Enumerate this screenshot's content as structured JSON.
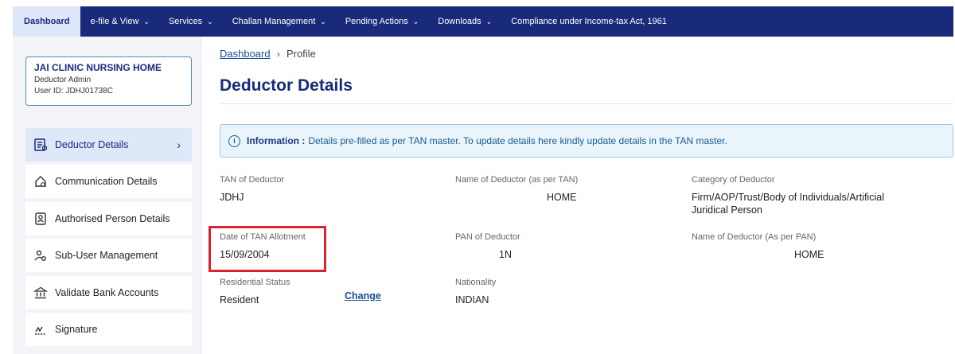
{
  "nav": {
    "items": [
      {
        "label": "Dashboard",
        "active": true
      },
      {
        "label": "e-file & View",
        "dropdown": true
      },
      {
        "label": "Services",
        "dropdown": true
      },
      {
        "label": "Challan Management",
        "dropdown": true
      },
      {
        "label": "Pending Actions",
        "dropdown": true
      },
      {
        "label": "Downloads",
        "dropdown": true
      },
      {
        "label": "Compliance under Income-tax Act, 1961"
      }
    ]
  },
  "user": {
    "name": "JAI CLINIC NURSING HOME",
    "role": "Deductor Admin",
    "user_id": "User ID: JDHJ01738C"
  },
  "sidebar": {
    "items": [
      {
        "label": "Deductor Details",
        "icon": "document-list-icon",
        "active": true
      },
      {
        "label": "Communication Details",
        "icon": "home-gear-icon"
      },
      {
        "label": "Authorised Person Details",
        "icon": "id-card-icon"
      },
      {
        "label": "Sub-User Management",
        "icon": "users-gear-icon"
      },
      {
        "label": "Validate Bank Accounts",
        "icon": "bank-icon"
      },
      {
        "label": "Signature",
        "icon": "signature-icon"
      }
    ]
  },
  "breadcrumb": {
    "root": "Dashboard",
    "separator": "›",
    "current": "Profile"
  },
  "page_title": "Deductor Details",
  "info": {
    "label": "Information :",
    "text": "Details pre-filled as per TAN master. To update details here kindly update details in the TAN master."
  },
  "fields": {
    "tan": {
      "label": "TAN of Deductor",
      "value": "JDHJ"
    },
    "name_tan": {
      "label": "Name of Deductor (as per TAN)",
      "value": "HOME"
    },
    "category": {
      "label": "Category of Deductor",
      "value": "Firm/AOP/Trust/Body of Individuals/Artificial Juridical Person"
    },
    "date_tan": {
      "label": "Date of TAN Allotment",
      "value": "15/09/2004"
    },
    "pan": {
      "label": "PAN of Deductor",
      "value": "1N"
    },
    "name_pan": {
      "label": "Name of Deductor (As per PAN)",
      "value": "HOME"
    },
    "residential": {
      "label": "Residential Status",
      "value": "Resident",
      "action": "Change"
    },
    "nationality": {
      "label": "Nationality",
      "value": "INDIAN"
    }
  },
  "colors": {
    "nav_bg": "#1a2a7a",
    "accent": "#1a2a7a",
    "info_bg": "#eaf4fb",
    "highlight": "#d9232e"
  }
}
